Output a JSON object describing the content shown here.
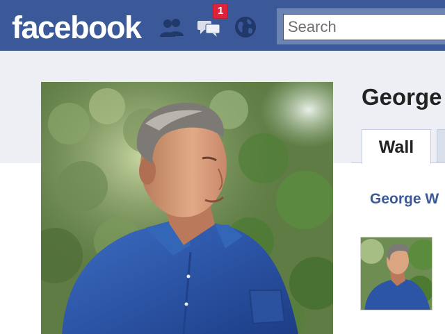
{
  "header": {
    "logo": "facebook",
    "notification_count": "1",
    "search": {
      "placeholder": "Search",
      "value": ""
    },
    "icons": [
      "friend-requests-icon",
      "messages-icon",
      "notifications-globe-icon"
    ]
  },
  "profile": {
    "name": "George",
    "tabs": [
      {
        "label": "Wall",
        "selected": true
      }
    ],
    "wall_post_author": "George W"
  },
  "colors": {
    "brand_blue": "#3b5998",
    "badge_red": "#e0223a",
    "page_bg": "#edeff4",
    "link_blue": "#3b5998"
  }
}
